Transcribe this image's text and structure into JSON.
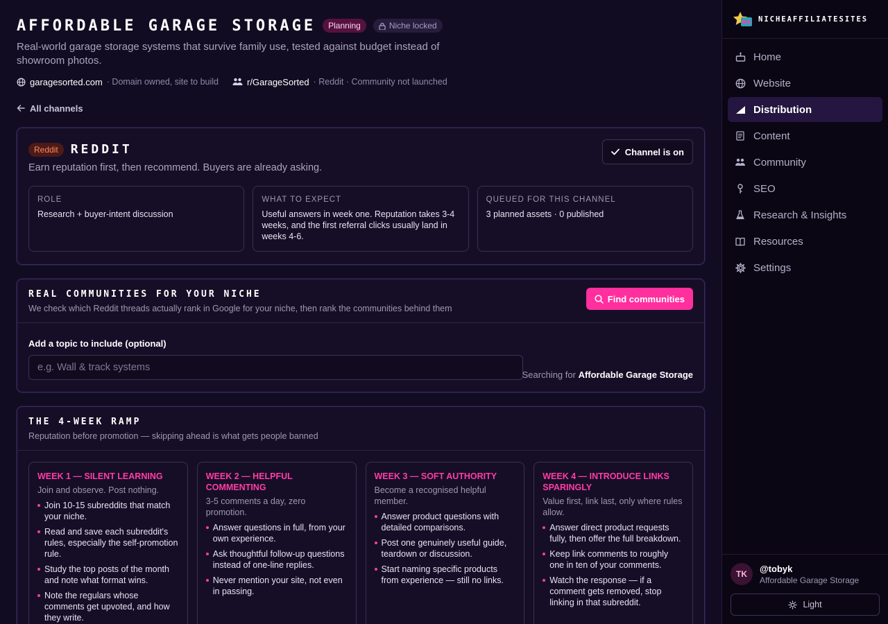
{
  "header": {
    "title": "Affordable Garage Storage",
    "status_badge": "Planning",
    "lock_badge": "Niche locked",
    "subtitle": "Real-world garage storage systems that survive family use, tested against budget instead of showroom photos.",
    "domain": "garagesorted.com",
    "domain_status": "· Domain owned, site to build",
    "community": "r/GarageSorted",
    "community_status": "· Reddit · Community not launched",
    "back_link": "All channels"
  },
  "reddit_card": {
    "badge": "Reddit",
    "title": "Reddit",
    "subtitle": "Earn reputation first, then recommend. Buyers are already asking.",
    "channel_button": "Channel is on",
    "info": [
      {
        "label": "Role",
        "value": "Research + buyer-intent discussion"
      },
      {
        "label": "What to expect",
        "value": "Useful answers in week one. Reputation takes 3-4 weeks, and the first referral clicks usually land in weeks 4-6."
      },
      {
        "label": "Queued for this channel",
        "value": "3 planned assets · 0 published"
      }
    ]
  },
  "communities_card": {
    "title": "Real communities for your niche",
    "subtitle": "We check which Reddit threads actually rank in Google for your niche, then rank the communities behind them",
    "find_button": "Find communities",
    "field_label": "Add a topic to include (optional)",
    "placeholder": "e.g. Wall & track systems",
    "searching_prefix": "Searching for",
    "searching_value": "Affordable Garage Storage"
  },
  "ramp_card": {
    "title": "The 4-week ramp",
    "subtitle": "Reputation before promotion — skipping ahead is what gets people banned",
    "weeks": [
      {
        "title": "Week 1 — Silent learning",
        "subtitle": "Join and observe. Post nothing.",
        "items": [
          "Join 10-15 subreddits that match your niche.",
          "Read and save each subreddit's rules, especially the self-promotion rule.",
          "Study the top posts of the month and note what format wins.",
          "Note the regulars whose comments get upvoted, and how they write."
        ]
      },
      {
        "title": "Week 2 — Helpful commenting",
        "subtitle": "3-5 comments a day, zero promotion.",
        "items": [
          "Answer questions in full, from your own experience.",
          "Ask thoughtful follow-up questions instead of one-line replies.",
          "Never mention your site, not even in passing."
        ]
      },
      {
        "title": "Week 3 — Soft authority",
        "subtitle": "Become a recognised helpful member.",
        "items": [
          "Answer product questions with detailed comparisons.",
          "Post one genuinely useful guide, teardown or discussion.",
          "Start naming specific products from experience — still no links."
        ]
      },
      {
        "title": "Week 4 — Introduce links sparingly",
        "subtitle": "Value first, link last, only where rules allow.",
        "items": [
          "Answer direct product requests fully, then offer the full breakdown.",
          "Keep link comments to roughly one in ten of your comments.",
          "Watch the response — if a comment gets removed, stop linking in that subreddit."
        ]
      }
    ]
  },
  "sidebar": {
    "brand": "NicheAffiliateSites",
    "brand_mark": "NS",
    "nav": [
      {
        "label": "Home",
        "icon": "home-icon"
      },
      {
        "label": "Website",
        "icon": "globe-icon"
      },
      {
        "label": "Distribution",
        "icon": "bar-chart-icon"
      },
      {
        "label": "Content",
        "icon": "document-icon"
      },
      {
        "label": "Community",
        "icon": "people-icon"
      },
      {
        "label": "SEO",
        "icon": "key-icon"
      },
      {
        "label": "Research & Insights",
        "icon": "flask-icon"
      },
      {
        "label": "Resources",
        "icon": "book-icon"
      },
      {
        "label": "Settings",
        "icon": "gear-icon"
      }
    ],
    "active_item": "Distribution",
    "user": {
      "initials": "TK",
      "handle": "@tobyk",
      "site": "Affordable Garage Storage"
    },
    "theme_button": "Light"
  },
  "colors": {
    "background": "#120c22",
    "accent": "#ff2f9e",
    "week_title": "#ff3da6",
    "reddit_badge": "#ff8a5b"
  }
}
